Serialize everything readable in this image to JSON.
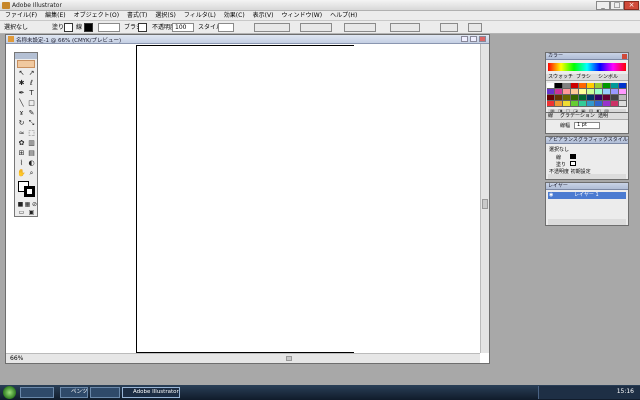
{
  "app": {
    "title": "Adobe Illustrator"
  },
  "menu": [
    "ファイル(F)",
    "編集(E)",
    "オブジェクト(O)",
    "書式(T)",
    "選択(S)",
    "フィルタ(L)",
    "効果(C)",
    "表示(V)",
    "ウィンドウ(W)",
    "ヘルプ(H)"
  ],
  "options": {
    "sel_label": "選択なし",
    "fill_label": "塗り",
    "stroke_label": "線",
    "brush_label": "ブラシ",
    "opacity_label": "不透明度",
    "opacity_value": "100",
    "style_label": "スタイル"
  },
  "document": {
    "title": "名称未設定-1 @ 66% (CMYK/プレビュー)",
    "zoom": "66%"
  },
  "panels": {
    "color": {
      "tab": "カラー"
    },
    "swatches": {
      "tab1": "スウォッチ",
      "tab2": "ブラシ",
      "tab3": "シンボル"
    },
    "stroke": {
      "tab1": "線",
      "tab2": "グラデーション",
      "tab3": "透明",
      "weight_label": "線幅",
      "weight_value": "1 pt"
    },
    "appearance": {
      "tab1": "アピアランス",
      "tab2": "グラフィックスタイル",
      "item_label": "選択なし",
      "stroke_label": "線",
      "fill_label": "塗り",
      "opacity_label": "不透明度 初期設定"
    },
    "layers": {
      "tab1": "レイヤー",
      "layer_name": "レイヤー 1"
    }
  },
  "taskbar": {
    "items": [
      "",
      "ペンツール",
      "",
      "Adobe Illustrator"
    ],
    "clock": "15:16"
  }
}
